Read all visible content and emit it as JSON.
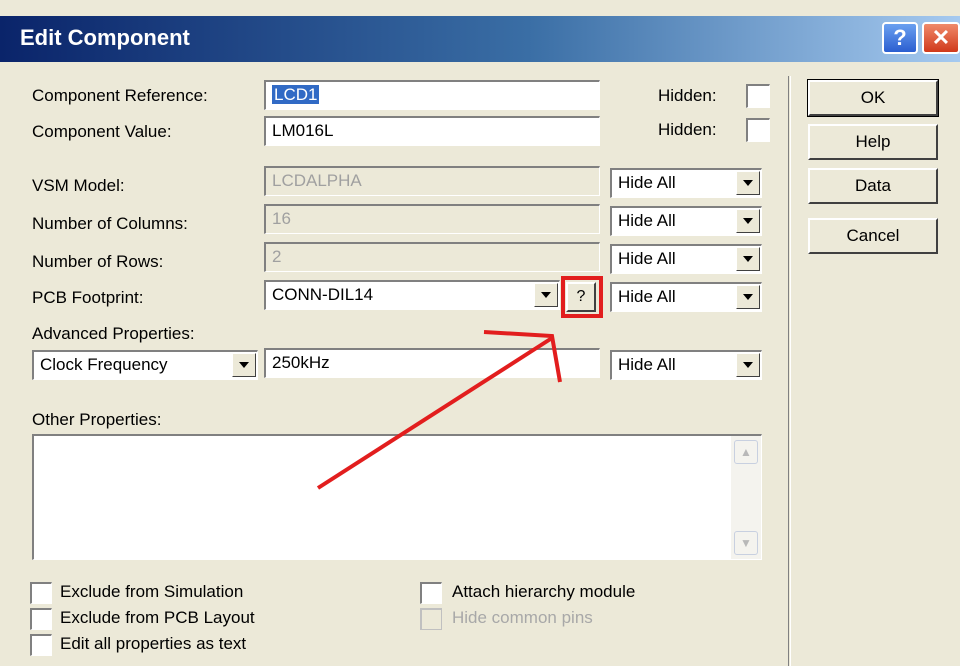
{
  "window": {
    "title": "Edit Component",
    "help_glyph": "?",
    "close_glyph": "✕"
  },
  "fields": {
    "reference": {
      "label": "Component Reference:",
      "value": "LCD1",
      "hidden_label": "Hidden:"
    },
    "value": {
      "label": "Component Value:",
      "value": "LM016L",
      "hidden_label": "Hidden:"
    },
    "vsm_model": {
      "label": "VSM Model:",
      "value": "LCDALPHA",
      "visibility": "Hide All"
    },
    "columns": {
      "label": "Number of Columns:",
      "value": "16",
      "visibility": "Hide All"
    },
    "rows": {
      "label": "Number of Rows:",
      "value": "2",
      "visibility": "Hide All"
    },
    "pcb_footprint": {
      "label": "PCB Footprint:",
      "value": "CONN-DIL14",
      "browse_label": "?",
      "visibility": "Hide All"
    },
    "advanced": {
      "label": "Advanced Properties:",
      "property": "Clock Frequency",
      "value": "250kHz",
      "visibility": "Hide All"
    },
    "other": {
      "label": "Other Properties:",
      "value": ""
    }
  },
  "buttons": {
    "ok": "OK",
    "help": "Help",
    "data": "Data",
    "cancel": "Cancel"
  },
  "checkboxes": {
    "exclude_sim": "Exclude from Simulation",
    "exclude_pcb": "Exclude from PCB Layout",
    "edit_text": "Edit all properties as text",
    "attach_hier": "Attach hierarchy module",
    "hide_pins": "Hide common pins"
  },
  "colors": {
    "annotation": "#E21E1E",
    "selection": "#316AC5"
  }
}
